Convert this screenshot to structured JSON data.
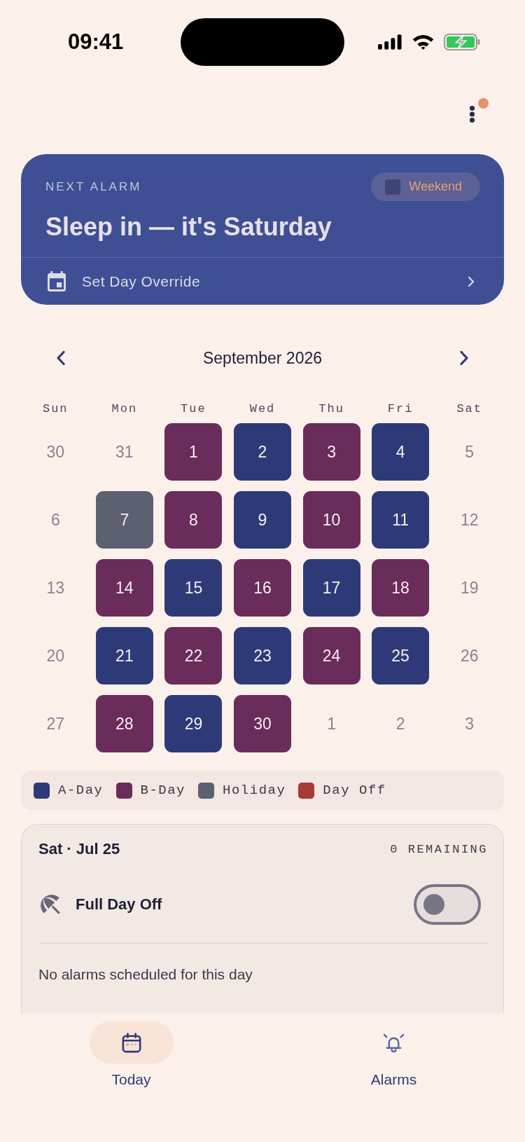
{
  "status_bar": {
    "time": "09:41"
  },
  "menu": {
    "badge": true
  },
  "next_alarm": {
    "label": "NEXT ALARM",
    "tag": "Weekend",
    "title": "Sleep in — it's Saturday",
    "override": "Set Day Override"
  },
  "calendar": {
    "month": "September 2026",
    "weekdays": [
      "Sun",
      "Mon",
      "Tue",
      "Wed",
      "Thu",
      "Fri",
      "Sat"
    ],
    "days": [
      {
        "label": "30",
        "kind": "none"
      },
      {
        "label": "31",
        "kind": "none"
      },
      {
        "label": "1",
        "kind": "b_day"
      },
      {
        "label": "2",
        "kind": "a_day"
      },
      {
        "label": "3",
        "kind": "b_day"
      },
      {
        "label": "4",
        "kind": "a_day"
      },
      {
        "label": "5",
        "kind": "none"
      },
      {
        "label": "6",
        "kind": "none"
      },
      {
        "label": "7",
        "kind": "holiday"
      },
      {
        "label": "8",
        "kind": "b_day"
      },
      {
        "label": "9",
        "kind": "a_day"
      },
      {
        "label": "10",
        "kind": "b_day"
      },
      {
        "label": "11",
        "kind": "a_day"
      },
      {
        "label": "12",
        "kind": "none"
      },
      {
        "label": "13",
        "kind": "none"
      },
      {
        "label": "14",
        "kind": "b_day"
      },
      {
        "label": "15",
        "kind": "a_day"
      },
      {
        "label": "16",
        "kind": "b_day"
      },
      {
        "label": "17",
        "kind": "a_day"
      },
      {
        "label": "18",
        "kind": "b_day"
      },
      {
        "label": "19",
        "kind": "none"
      },
      {
        "label": "20",
        "kind": "none"
      },
      {
        "label": "21",
        "kind": "a_day"
      },
      {
        "label": "22",
        "kind": "b_day"
      },
      {
        "label": "23",
        "kind": "a_day"
      },
      {
        "label": "24",
        "kind": "b_day"
      },
      {
        "label": "25",
        "kind": "a_day"
      },
      {
        "label": "26",
        "kind": "none"
      },
      {
        "label": "27",
        "kind": "none"
      },
      {
        "label": "28",
        "kind": "b_day"
      },
      {
        "label": "29",
        "kind": "a_day"
      },
      {
        "label": "30",
        "kind": "b_day"
      },
      {
        "label": "1",
        "kind": "none"
      },
      {
        "label": "2",
        "kind": "none"
      },
      {
        "label": "3",
        "kind": "none"
      }
    ]
  },
  "legend": [
    {
      "kind": "a_day",
      "label": "A-Day",
      "color": "#2e3a78"
    },
    {
      "kind": "b_day",
      "label": "B-Day",
      "color": "#6a2c5a"
    },
    {
      "kind": "holiday",
      "label": "Holiday",
      "color": "#5c6070"
    },
    {
      "kind": "day_off",
      "label": "Day Off",
      "color": "#a83a35"
    }
  ],
  "day_detail": {
    "date": "Sat · Jul 25",
    "remaining": "0 REMAINING",
    "day_off": {
      "label": "Full Day Off",
      "on": false
    },
    "empty": "No alarms scheduled for this day"
  },
  "nav": [
    {
      "label": "Today",
      "selected": true
    },
    {
      "label": "Alarms",
      "selected": false
    }
  ]
}
